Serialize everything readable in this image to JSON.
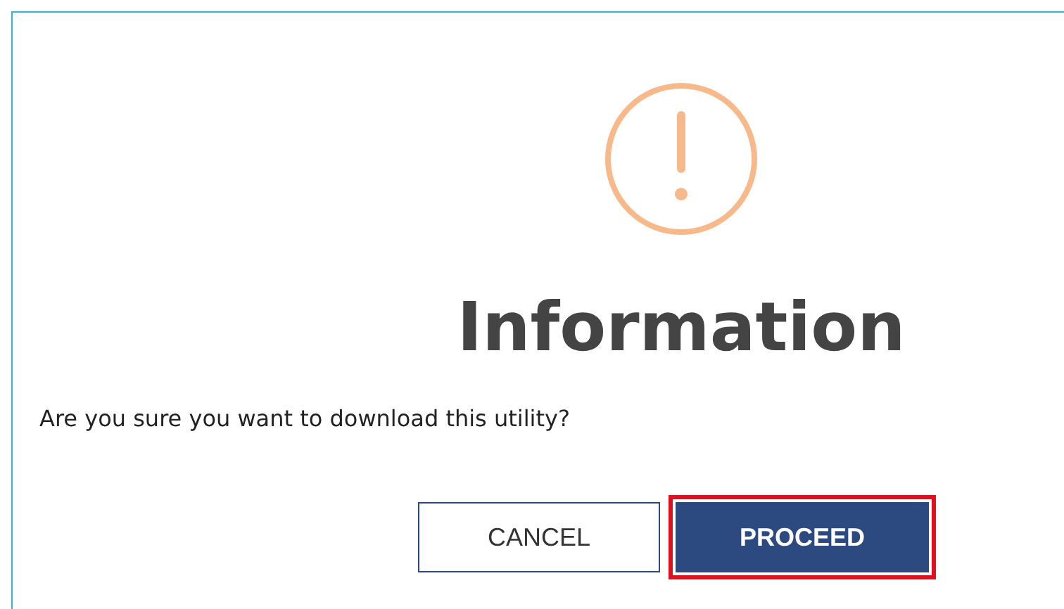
{
  "dialog": {
    "title": "Information",
    "message": "Are you sure you want to download this utility?",
    "buttons": [
      {
        "label": "CANCEL",
        "kind": "secondary",
        "highlighted": false
      },
      {
        "label": "PROCEED",
        "kind": "primary",
        "highlighted": true
      }
    ]
  }
}
